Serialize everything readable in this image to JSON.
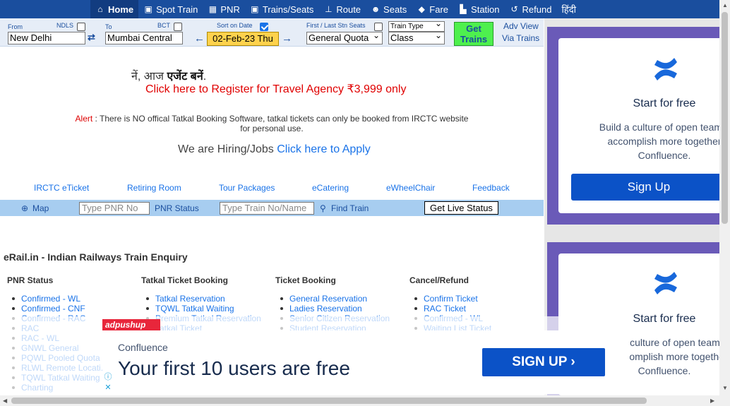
{
  "nav": {
    "items": [
      {
        "label": "Home",
        "icon": "home-icon",
        "glyph": "⌂",
        "active": true
      },
      {
        "label": "Spot Train",
        "icon": "train-icon",
        "glyph": "▣"
      },
      {
        "label": "PNR",
        "icon": "grid-icon",
        "glyph": "▦"
      },
      {
        "label": "Trains/Seats",
        "icon": "coach-icon",
        "glyph": "▣"
      },
      {
        "label": "Route",
        "icon": "signpost-icon",
        "glyph": "⊥"
      },
      {
        "label": "Seats",
        "icon": "users-icon",
        "glyph": "☻"
      },
      {
        "label": "Fare",
        "icon": "tag-icon",
        "glyph": "◆"
      },
      {
        "label": "Station",
        "icon": "station-icon",
        "glyph": "▙"
      },
      {
        "label": "Refund",
        "icon": "undo-icon",
        "glyph": "↺"
      },
      {
        "label": "हिंदी",
        "icon": "",
        "glyph": ""
      }
    ]
  },
  "search": {
    "from_label": "From",
    "from_code": "NDLS",
    "from_value": "New Delhi",
    "to_label": "To",
    "to_code": "BCT",
    "to_value": "Mumbai Central",
    "sort_label": "Sort on Date",
    "sort_checked": true,
    "date_value": "02-Feb-23 Thu",
    "stn_label": "First / Last Stn Seats",
    "quota_value": "General Quota",
    "train_type_value": "Train Type",
    "class_value": "Class",
    "get_trains_label": "Get Trains",
    "adv_view_label": "Adv View",
    "via_trains_label": "Via Trains"
  },
  "promo": {
    "hindi_prefix": "नें, आज ",
    "hindi_bold": "एजेंट बनें",
    "hindi_suffix": ".",
    "register_text": "Click here to Register for Travel Agency ₹3,999 only",
    "alert_label": "Alert",
    "alert_text": " : There is NO offical Tatkal Booking Software, tatkal tickets can only be booked from IRCTC website for personal use.",
    "hiring_text": "We are Hiring/Jobs ",
    "hiring_link": "Click here to Apply"
  },
  "links": [
    "IRCTC eTicket",
    "Retiring Room",
    "Tour Packages",
    "eCatering",
    "eWheelChair",
    "Feedback"
  ],
  "band": {
    "map_label": "Map",
    "pnr_placeholder": "Type PNR No",
    "pnr_status_label": "PNR Status",
    "train_placeholder": "Type Train No/Name",
    "find_train_label": "Find Train",
    "live_status_label": "Get Live Status"
  },
  "main": {
    "heading": "eRail.in - Indian Railways Train Enquiry",
    "columns": [
      {
        "title": "PNR Status",
        "items": [
          "Confirmed - WL",
          "Confirmed - CNF",
          "Confirmed - RAC",
          "RAC",
          "RAC - WL",
          "GNWL General",
          "PQWL Pooled Quota",
          "RLWL Remote Locati...",
          "TQWL Tatkal Waiting",
          "Charting"
        ]
      },
      {
        "title": "Tatkal Ticket Booking",
        "items": [
          "Tatkal Reservation",
          "TQWL Tatkal Waiting",
          "Premium Tatkal Reservation",
          "Tatkal Ticket"
        ]
      },
      {
        "title": "Ticket Booking",
        "items": [
          "General Reservation",
          "Ladies Reservation",
          "Senior Citizen Reservation",
          "Student Reservation"
        ]
      },
      {
        "title": "Cancel/Refund",
        "items": [
          "Confirm Ticket",
          "RAC Ticket",
          "Confirmed - WL",
          "Waiting List Ticket"
        ]
      }
    ]
  },
  "side_ads": [
    {
      "title": "Start for free",
      "body_line1": "Build a culture of open teamw",
      "body_line2": "accomplish more together",
      "body_line3": "Confluence.",
      "button": "Sign Up"
    },
    {
      "title": "Start for free",
      "body_line1": "culture of open teamw",
      "body_line2": "omplish more together",
      "body_line3": "Confluence."
    }
  ],
  "bottom_ad": {
    "network": "adpushup",
    "brand": "Confluence",
    "headline": "Your first 10 users are free",
    "button": "SIGN UP ›"
  },
  "colors": {
    "nav": "#1a4e9e",
    "band": "#a7cdf0",
    "date": "#ffd24d",
    "get_trains": "#4ef04e",
    "ad_purple": "#6a5ab8",
    "ad_button": "#0b52c7"
  }
}
